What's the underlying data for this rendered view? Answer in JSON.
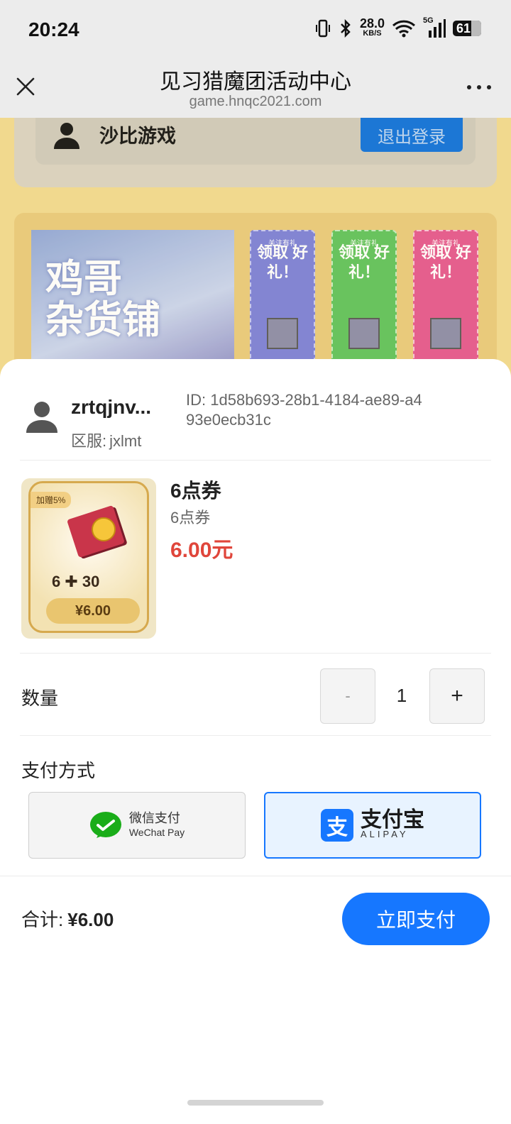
{
  "status_bar": {
    "time": "20:24",
    "net_speed_value": "28.0",
    "net_speed_unit": "KB/S",
    "signal_label": "5G",
    "battery": "61"
  },
  "titlebar": {
    "title": "见习猎魔团活动中心",
    "url": "game.hnqc2021.com"
  },
  "background_page": {
    "username": "沙比游戏",
    "logout_label": "退出登录",
    "banner_text_line1": "鸡哥",
    "banner_text_line2": "杂货铺",
    "gift_cards": [
      {
        "subtitle": "关注有礼",
        "text": "领取 好礼！",
        "color": "#7a7ed8"
      },
      {
        "subtitle": "关注有礼",
        "text": "领取 好礼！",
        "color": "#5ec25a"
      },
      {
        "subtitle": "关注有礼",
        "text": "领取 好礼！",
        "color": "#e4558d"
      }
    ]
  },
  "sheet": {
    "user": {
      "name": "zrtqjnv...",
      "server_label": "区服:",
      "server": "jxlmt",
      "id_label": "ID:",
      "id": "1d58b693-28b1-4184-ae89-a493e0ecb31c"
    },
    "product": {
      "name": "6点券",
      "subtitle": "6点券",
      "price": "6.00元",
      "image": {
        "tag": "加赠5%",
        "combo": "6 ✚ 30",
        "price_pill": "¥6.00"
      }
    },
    "quantity": {
      "label": "数量",
      "minus": "-",
      "value": "1",
      "plus": "+"
    },
    "payment": {
      "label": "支付方式",
      "wechat_cn": "微信支付",
      "wechat_en": "WeChat Pay",
      "alipay_cn": "支付宝",
      "alipay_en": "ALIPAY",
      "selected": "alipay"
    },
    "total": {
      "label": "合计:",
      "amount": "¥6.00"
    },
    "pay_button": "立即支付"
  },
  "colors": {
    "accent": "#1677ff",
    "price_red": "#e0463b",
    "page_bg": "#f3d98e"
  }
}
